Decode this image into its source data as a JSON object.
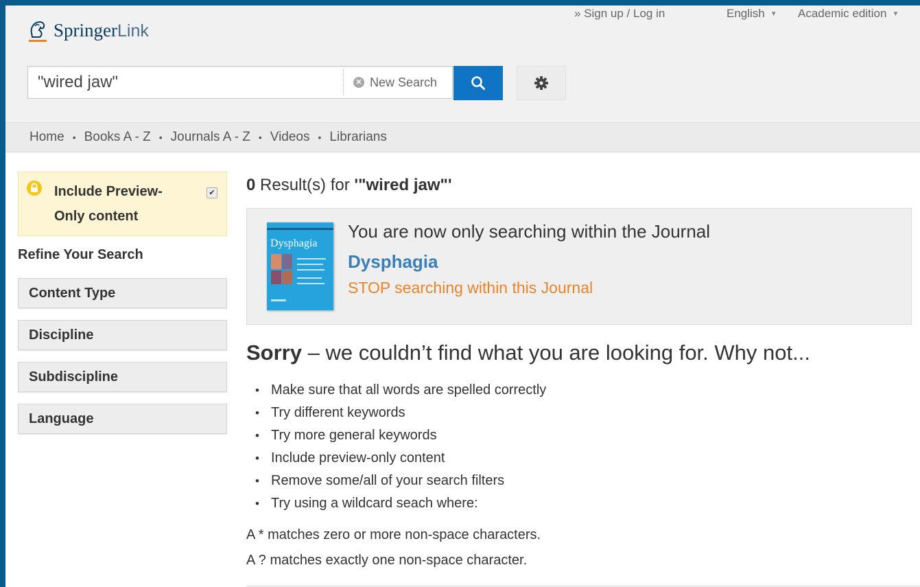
{
  "header": {
    "logo_primary": "Springer",
    "logo_secondary": "Link",
    "signup": "» Sign up / Log in",
    "language": "English",
    "edition": "Academic edition"
  },
  "search": {
    "value": "\"wired jaw\"",
    "new_search_label": "New Search"
  },
  "nav": {
    "items": [
      "Home",
      "Books A - Z",
      "Journals A - Z",
      "Videos",
      "Librarians"
    ]
  },
  "sidebar": {
    "preview_label": "Include Preview-Only content",
    "preview_checked": true,
    "refine_title": "Refine Your Search",
    "facets": [
      "Content Type",
      "Discipline",
      "Subdiscipline",
      "Language"
    ]
  },
  "results": {
    "count": "0",
    "label": " Result(s) for ",
    "query": "'\"wired jaw\"'"
  },
  "journal": {
    "intro": "You are now only searching within the Journal",
    "name": "Dysphagia",
    "stop": "STOP searching within this Journal"
  },
  "sorry": {
    "bold": "Sorry",
    "rest": " – we couldn’t find what you are looking for. Why not..."
  },
  "tips": [
    "Make sure that all words are spelled correctly",
    "Try different keywords",
    "Try more general keywords",
    "Include preview-only content",
    "Remove some/all of your search filters",
    "Try using a wildcard seach where:"
  ],
  "wildcards": [
    "A * matches zero or more non-space characters.",
    "A ? matches exactly one non-space character."
  ],
  "colors": {
    "brand": "#0a3d62",
    "search_button": "#1074c5",
    "link": "#3a7fba",
    "stop": "#e88427",
    "preview_bg": "#fdf5d3"
  },
  "icons": {
    "search": "search-icon",
    "settings": "gear-icon",
    "lock": "lock-icon",
    "clear": "clear-icon"
  }
}
